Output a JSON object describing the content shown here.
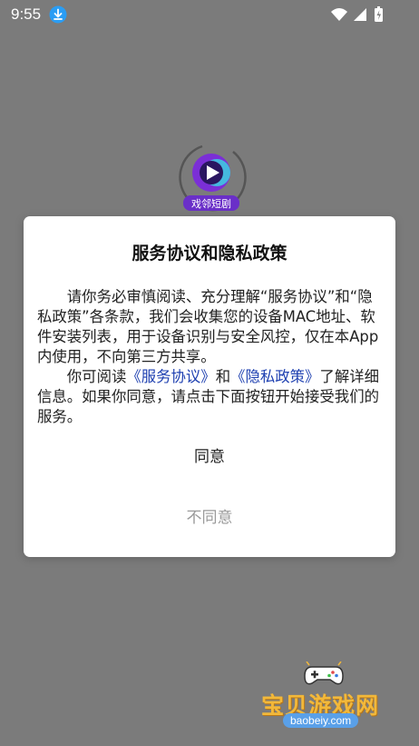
{
  "status_bar": {
    "time": "9:55"
  },
  "splash": {
    "logo_label": "戏邻短剧"
  },
  "dialog": {
    "title": "服务协议和隐私政策",
    "para1": "请你务必审慎阅读、充分理解“服务协议”和“隐私政策”各条款，我们会收集您的设备MAC地址、软件安装列表，用于设备识别与安全风控，仅在本App内使用，不向第三方共享。",
    "para2_prefix": "你可阅读",
    "link_service": "《服务协议》",
    "para2_and": "和",
    "link_privacy": "《隐私政策》",
    "para2_suffix": "了解详细信息。如果你同意，请点击下面按钮开始接受我们的服务。",
    "agree_label": "同意",
    "disagree_label": "不同意"
  },
  "watermark": {
    "brand": "宝贝游戏网",
    "url": "baobeiy.com"
  },
  "colors": {
    "overlay": "#7b7b7b",
    "link": "#1d3fb0",
    "disagree": "#9a9a9a",
    "download_badge": "#2a9df4"
  }
}
